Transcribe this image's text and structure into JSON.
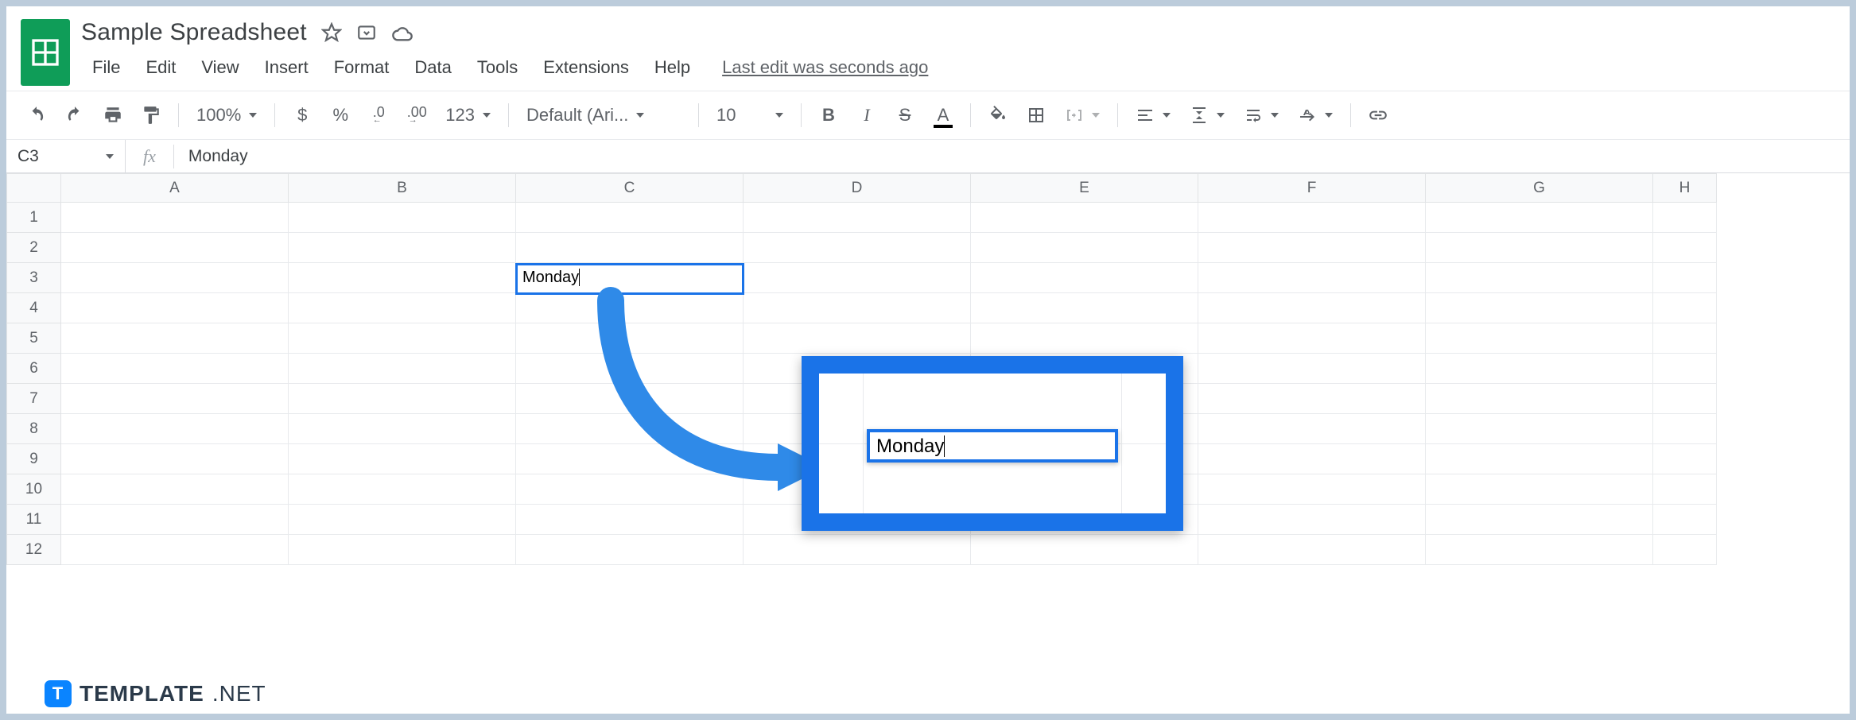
{
  "header": {
    "title": "Sample Spreadsheet",
    "last_edit": "Last edit was seconds ago"
  },
  "menu": {
    "items": [
      "File",
      "Edit",
      "View",
      "Insert",
      "Format",
      "Data",
      "Tools",
      "Extensions",
      "Help"
    ]
  },
  "toolbar": {
    "zoom": "100%",
    "currency": "$",
    "percent": "%",
    "decrease_decimal": ".0",
    "increase_decimal": ".00",
    "more_formats": "123",
    "font_name": "Default (Ari...",
    "font_size": "10",
    "bold": "B",
    "italic": "I",
    "strike": "S",
    "text_color": "A"
  },
  "namebox": {
    "ref": "C3",
    "fx": "fx",
    "formula": "Monday"
  },
  "columns": [
    "A",
    "B",
    "C",
    "D",
    "E",
    "F",
    "G",
    "H"
  ],
  "rows": [
    "1",
    "2",
    "3",
    "4",
    "5",
    "6",
    "7",
    "8",
    "9",
    "10",
    "11",
    "12"
  ],
  "cells": {
    "C3": "Monday"
  },
  "annotation": {
    "zoom_cell_value": "Monday"
  },
  "watermark": {
    "logo_letter": "T",
    "brand": "TEMPLATE",
    "suffix": ".NET"
  }
}
